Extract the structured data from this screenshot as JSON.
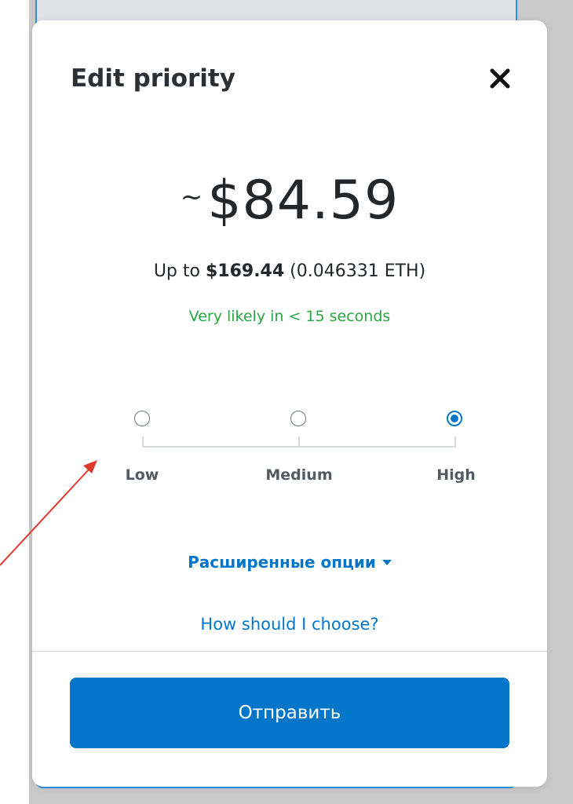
{
  "modal": {
    "title": "Edit priority",
    "amount_prefix": "~",
    "amount": "$84.59",
    "max_prefix": "Up to",
    "max_amount": "$169.44",
    "max_eth": "(0.046331 ETH)",
    "estimate_text": "Very likely in < 15 seconds",
    "priority_options": [
      {
        "label": "Low",
        "selected": false
      },
      {
        "label": "Medium",
        "selected": false
      },
      {
        "label": "High",
        "selected": true
      }
    ],
    "advanced_options_label": "Расширенные опции",
    "help_link": "How should I choose?",
    "submit_label": "Отправить"
  },
  "colors": {
    "accent": "#0376c9",
    "success": "#28a745",
    "annotation_arrow": "#e03a2f"
  },
  "icons": {
    "close": "close-icon",
    "advanced_caret": "caret-down-icon",
    "annotation": "red-arrow-annotation"
  }
}
